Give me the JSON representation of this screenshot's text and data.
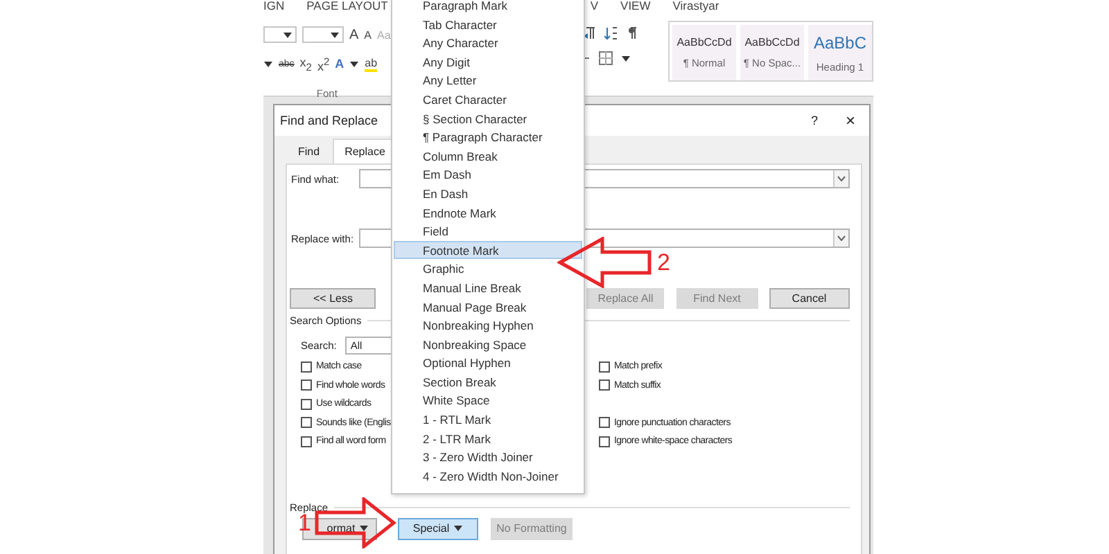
{
  "ribbon": {
    "tabs": [
      "IGN",
      "PAGE LAYOUT",
      "V",
      "VIEW",
      "Virastyar"
    ],
    "font_group": {
      "label": "Font",
      "row1": [
        "A",
        "A",
        "Aa"
      ],
      "row2": [
        "abc",
        "x$_{2}$",
        "x$^{2}$",
        "A",
        "ab"
      ]
    },
    "styles": [
      {
        "sample": "AaBbCcDd",
        "name": "¶ Normal",
        "kind": "body"
      },
      {
        "sample": "AaBbCcDd",
        "name": "¶ No Spac...",
        "kind": "body"
      },
      {
        "sample": "AaBbC",
        "name": "Heading 1",
        "kind": "heading"
      }
    ]
  },
  "dialog": {
    "title": "Find and Replace",
    "help": "?",
    "close": "×",
    "tabs": [
      {
        "label": "Find",
        "selected": false
      },
      {
        "label": "Replace",
        "selected": true
      }
    ],
    "fields": [
      {
        "label": "Find what:"
      },
      {
        "label": "Replace with:"
      }
    ],
    "buttons": [
      {
        "label": "<< Less",
        "disabled": false
      },
      {
        "label": "Replace All",
        "disabled": true
      },
      {
        "label": "Find Next",
        "disabled": true
      },
      {
        "label": "Cancel",
        "disabled": false
      }
    ],
    "search_options": {
      "title": "Search Options",
      "search_label": "Search:",
      "search_value": "All",
      "left": [
        {
          "label": "Match case",
          "checked": false
        },
        {
          "label": "Find whole words",
          "checked": false
        },
        {
          "label": "Use wildcards",
          "checked": false
        },
        {
          "label": "Sounds like (Englis",
          "checked": false
        },
        {
          "label": "Find all word form",
          "checked": false
        }
      ],
      "right": [
        {
          "label": "Match prefix",
          "checked": false
        },
        {
          "label": "Match suffix",
          "checked": false
        },
        {
          "label": "Ignore punctuation characters",
          "checked": false
        },
        {
          "label": "Ignore white-space characters",
          "checked": false
        }
      ]
    },
    "replace_section": {
      "title": "Replace",
      "buttons": [
        {
          "label": "ormat",
          "disabled": false,
          "selected": false
        },
        {
          "label": "Special",
          "disabled": false,
          "selected": true
        },
        {
          "label": "No Formatting",
          "disabled": true,
          "selected": false
        }
      ]
    }
  },
  "menu": {
    "items": [
      {
        "label": "Paragraph Mark",
        "selected": false
      },
      {
        "label": "Tab Character",
        "selected": false
      },
      {
        "label": "Any Character",
        "selected": false
      },
      {
        "label": "Any Digit",
        "selected": false
      },
      {
        "label": "Any Letter",
        "selected": false
      },
      {
        "label": "Caret Character",
        "selected": false
      },
      {
        "label": "§ Section Character",
        "selected": false
      },
      {
        "label": "¶ Paragraph Character",
        "selected": false
      },
      {
        "label": "Column Break",
        "selected": false
      },
      {
        "label": "Em Dash",
        "selected": false
      },
      {
        "label": "En Dash",
        "selected": false
      },
      {
        "label": "Endnote Mark",
        "selected": false
      },
      {
        "label": "Field",
        "selected": false
      },
      {
        "label": "Footnote Mark",
        "selected": true
      },
      {
        "label": "Graphic",
        "selected": false
      },
      {
        "label": "Manual Line Break",
        "selected": false
      },
      {
        "label": "Manual Page Break",
        "selected": false
      },
      {
        "label": "Nonbreaking Hyphen",
        "selected": false
      },
      {
        "label": "Nonbreaking Space",
        "selected": false
      },
      {
        "label": "Optional Hyphen",
        "selected": false
      },
      {
        "label": "Section Break",
        "selected": false
      },
      {
        "label": "White Space",
        "selected": false
      },
      {
        "label": "1 - RTL Mark",
        "selected": false
      },
      {
        "label": "2 - LTR Mark",
        "selected": false
      },
      {
        "label": "3 - Zero Width Joiner",
        "selected": false
      },
      {
        "label": "4 - Zero Width Non-Joiner",
        "selected": false
      }
    ]
  },
  "annotations": [
    {
      "number": "1",
      "kind": "right"
    },
    {
      "number": "2",
      "kind": "left"
    }
  ]
}
